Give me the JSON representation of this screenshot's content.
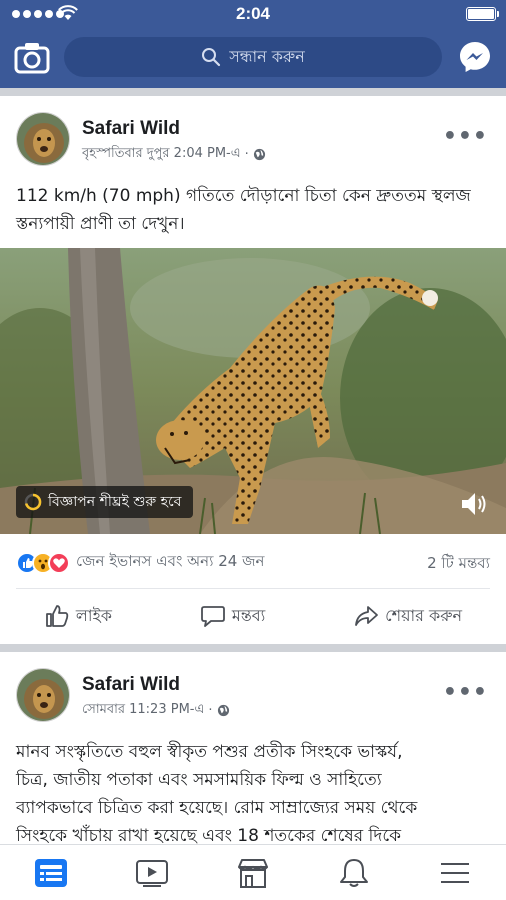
{
  "status_bar": {
    "time": "2:04"
  },
  "header": {
    "search_placeholder": "সন্ধান করুন"
  },
  "posts": [
    {
      "author": "Safari Wild",
      "time": "বৃহস্পতিবার দুপুর 2:04 PM-এ",
      "text_line1": "112 km/h (70 mph) গতিতে দৌড়ানো চিতা কেন দ্রুততম স্থলজ",
      "text_line2": "স্তন্যপায়ী প্রাণী তা দেখুন।",
      "ad_badge": "বিজ্ঞাপন শীঘ্রই শুরু হবে",
      "reactions_text": "জেন ইভানস এবং অন্য 24 জন",
      "comments": "2 টি মন্তব্য",
      "like_label": "লাইক",
      "comment_label": "মন্তব্য",
      "share_label": "শেয়ার করুন"
    },
    {
      "author": "Safari Wild",
      "time": "সোমবার 11:23 PM-এ",
      "text_line1": "মানব সংস্কৃতিতে বহুল স্বীকৃত পশুর প্রতীক সিংহকে ভাস্কর্য,",
      "text_line2": "চিত্র, জাতীয় পতাকা এবং সমসাময়িক ফিল্ম ও সাহিত্যে",
      "text_line3": "ব্যাপকভাবে চিত্রিত করা হয়েছে। রোম সাম্রাজ্যের সময় থেকে",
      "text_line4": "সিংহকে খাঁচায় রাখা হয়েছে এবং 18 শতকের শেষের দিকে"
    }
  ],
  "colors": {
    "brand": "#3b5998",
    "like_blue": "#1877f2",
    "love_red": "#f33e58",
    "wow_yellow": "#f7b125"
  }
}
